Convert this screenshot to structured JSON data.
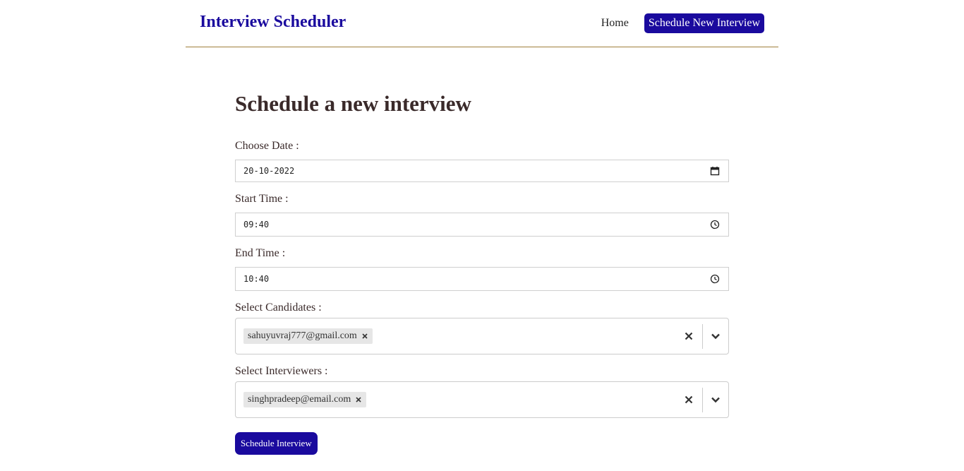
{
  "navbar": {
    "brand": "Interview Scheduler",
    "links": {
      "home": "Home",
      "schedule": "Schedule New Interview"
    }
  },
  "page": {
    "title": "Schedule a new interview"
  },
  "form": {
    "date": {
      "label": "Choose Date :",
      "value": "20-10-2022"
    },
    "start_time": {
      "label": "Start Time :",
      "value": "09:40"
    },
    "end_time": {
      "label": "End Time :",
      "value": "10:40"
    },
    "candidates": {
      "label": "Select Candidates :",
      "selected": [
        "sahuyuvraj777@gmail.com"
      ]
    },
    "interviewers": {
      "label": "Select Interviewers :",
      "selected": [
        "singhpradeep@email.com"
      ]
    },
    "submit_label": "Schedule Interview"
  },
  "icons": {
    "date": "calendar-icon",
    "time": "clock-icon",
    "remove": "close-icon",
    "dropdown": "chevron-down-icon"
  },
  "colors": {
    "brand": "#1a0a9e",
    "navbar_border": "#a07f3a",
    "text": "#3a2a2a",
    "chip_bg": "#e6e6e6"
  }
}
